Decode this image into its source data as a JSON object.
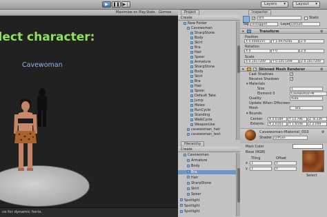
{
  "toolbar": {
    "play": "▶",
    "pause": "❚❚",
    "step": "▶❘",
    "layers": "Layers",
    "layout": "Layout"
  },
  "game": {
    "bar": {
      "maximize": "Maximize on Play",
      "stats": "Stats",
      "gizmos": "Gizmos"
    },
    "heading": "elect character:",
    "character_name": "Cavewoman",
    "status": "ce for dynamic fonts."
  },
  "project": {
    "tab": "Project",
    "create": "Create",
    "items": [
      {
        "label": "New Folder",
        "indent": 1
      },
      {
        "label": "Cavewoman",
        "indent": 2
      },
      {
        "label": "SharpStone",
        "indent": 3
      },
      {
        "label": "Body",
        "indent": 3
      },
      {
        "label": "Skirt",
        "indent": 3
      },
      {
        "label": "Bra",
        "indent": 3
      },
      {
        "label": "Hair",
        "indent": 3
      },
      {
        "label": "Spear",
        "indent": 3
      },
      {
        "label": "Armature",
        "indent": 3
      },
      {
        "label": "SharpStone",
        "indent": 3
      },
      {
        "label": "Body",
        "indent": 3
      },
      {
        "label": "Skirt",
        "indent": 3
      },
      {
        "label": "Bra",
        "indent": 3
      },
      {
        "label": "Hair",
        "indent": 3
      },
      {
        "label": "Spear",
        "indent": 3
      },
      {
        "label": "Default Take",
        "indent": 3
      },
      {
        "label": "Jump",
        "indent": 3
      },
      {
        "label": "Melee",
        "indent": 3
      },
      {
        "label": "RunCycle",
        "indent": 3
      },
      {
        "label": "Standing",
        "indent": 3
      },
      {
        "label": "WalkCycle",
        "indent": 3
      },
      {
        "label": "WeaponUse",
        "indent": 3
      },
      {
        "label": "cavewoman_hair",
        "indent": 2
      },
      {
        "label": "cavewoman_text",
        "indent": 2
      }
    ]
  },
  "hierarchy": {
    "tab": "Hierarchy",
    "create": "Create",
    "items": [
      {
        "label": "Cavewoman",
        "indent": 1,
        "selected": false
      },
      {
        "label": "Armature",
        "indent": 2,
        "selected": false
      },
      {
        "label": "Body",
        "indent": 2,
        "selected": false
      },
      {
        "label": "Bra",
        "indent": 2,
        "selected": true
      },
      {
        "label": "Hair",
        "indent": 2,
        "selected": false
      },
      {
        "label": "SharpStone",
        "indent": 2,
        "selected": false
      },
      {
        "label": "Skirt",
        "indent": 2,
        "selected": false
      },
      {
        "label": "Spear",
        "indent": 2,
        "selected": false
      },
      {
        "label": "Spotlight",
        "indent": 0,
        "selected": false
      },
      {
        "label": "Spotlight",
        "indent": 0,
        "selected": false
      },
      {
        "label": "Spotlight",
        "indent": 0,
        "selected": false
      }
    ]
  },
  "inspector": {
    "tab": "Inspector",
    "object_name": "Bra",
    "static": "Static",
    "tag_label": "Tag",
    "tag_value": "Untagged",
    "layer_label": "Layer",
    "layer_value": "Default",
    "transform": {
      "title": "Transform",
      "position": "Position",
      "position_values": [
        "X 0.0006197",
        "Y 1.097924e",
        "Z 0"
      ],
      "rotation": "Rotation",
      "rotation_values": [
        "X 0",
        "Y 0",
        "Z 0"
      ],
      "scale": "Scale",
      "scale_values": [
        "X 0.1017209",
        "Y 0.1017209",
        "Z 0.1017209"
      ]
    },
    "renderer": {
      "title": "Skinned Mesh Renderer",
      "cast_shadows": "Cast Shadows",
      "receive_shadows": "Receive Shadows",
      "materials": "Materials",
      "size_label": "Size",
      "size_value": "1",
      "element_label": "Element 0",
      "element_value": "Cavewoman-M",
      "quality_label": "Quality",
      "quality_value": "Auto",
      "update_offscreen": "Update When Offscreen",
      "mesh_label": "Mesh",
      "mesh_value": "Bra",
      "bounds": "Bounds",
      "center_label": "Center:",
      "center_values": [
        "X 0.0189",
        "Y 13.796",
        "Z -8.339"
      ],
      "extents_label": "Extents:",
      "extents_values": [
        "X 2.0103",
        "Y 1.6548",
        "Z 2.049"
      ]
    },
    "material": {
      "name": "Cavewoman-Material_003",
      "shader_label": "Shader",
      "shader_value": "Diffuse",
      "main_color": "Main Color",
      "base": "Base (RGB)",
      "tiling": "Tiling",
      "offset": "Offset",
      "tx": "x",
      "tx_val": "1",
      "ox_val": "0",
      "ty": "y",
      "ty_val": "1",
      "oy_val": "0",
      "select": "Select"
    }
  }
}
